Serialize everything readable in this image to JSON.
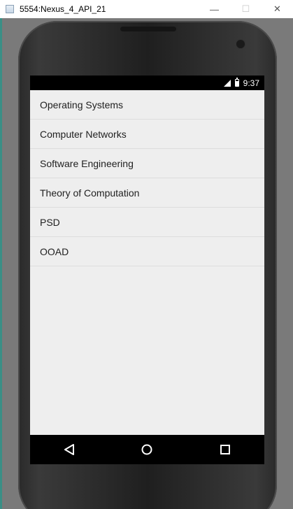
{
  "window": {
    "title": "5554:Nexus_4_API_21",
    "minimize": "—",
    "maximize": "☐",
    "close": "✕"
  },
  "status_bar": {
    "time": "9:37",
    "icons": [
      "signal-icon",
      "battery-icon"
    ]
  },
  "list": {
    "items": [
      "Operating Systems",
      "Computer Networks",
      "Software Engineering",
      "Theory of Computation",
      "PSD",
      "OOAD"
    ]
  },
  "nav_bar": {
    "buttons": [
      "back-icon",
      "home-icon",
      "recents-icon"
    ]
  }
}
